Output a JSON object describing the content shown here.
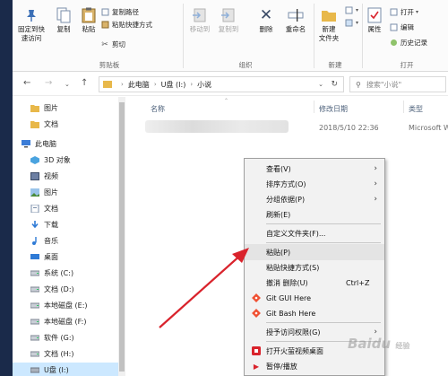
{
  "ribbon": {
    "pin": "固定到快\n速访问",
    "copy": "复制",
    "paste": "粘贴",
    "copy_path": "复制路径",
    "paste_shortcut": "粘贴快捷方式",
    "cut": "剪切",
    "clipboard_group": "剪贴板",
    "move_to": "移动到",
    "copy_to": "复制到",
    "delete": "删除",
    "rename": "重命名",
    "organize_group": "组织",
    "new_folder": "新建\n文件夹",
    "new_group": "新建",
    "properties": "属性",
    "open": "打开",
    "edit": "编辑",
    "history": "历史记录",
    "open_group": "打开"
  },
  "address": {
    "path": [
      "此电脑",
      "U盘 (I:)",
      "小说"
    ],
    "search_placeholder": "搜索\"小说\""
  },
  "nav": {
    "items": [
      {
        "label": "图片",
        "icon": "folder-icon"
      },
      {
        "label": "文档",
        "icon": "folder-icon"
      },
      {
        "label": "此电脑",
        "icon": "computer-icon"
      },
      {
        "label": "3D 对象",
        "icon": "cube-icon"
      },
      {
        "label": "视频",
        "icon": "video-icon"
      },
      {
        "label": "图片",
        "icon": "picture-icon"
      },
      {
        "label": "文档",
        "icon": "document-icon"
      },
      {
        "label": "下载",
        "icon": "download-icon"
      },
      {
        "label": "音乐",
        "icon": "music-icon"
      },
      {
        "label": "桌面",
        "icon": "desktop-icon"
      },
      {
        "label": "系统 (C:)",
        "icon": "drive-icon"
      },
      {
        "label": "文档 (D:)",
        "icon": "drive-icon"
      },
      {
        "label": "本地磁盘 (E:)",
        "icon": "drive-icon"
      },
      {
        "label": "本地磁盘 (F:)",
        "icon": "drive-icon"
      },
      {
        "label": "软件 (G:)",
        "icon": "drive-icon"
      },
      {
        "label": "文档 (H:)",
        "icon": "drive-icon"
      },
      {
        "label": "U盘 (I:)",
        "icon": "usb-drive-icon"
      }
    ]
  },
  "list": {
    "col_name": "名称",
    "col_date": "修改日期",
    "col_type": "类型",
    "row_date": "2018/5/10 22:36",
    "row_type": "Microsoft W"
  },
  "menu": {
    "view": "查看(V)",
    "sort": "排序方式(O)",
    "group": "分组依据(P)",
    "refresh": "刷新(E)",
    "customize": "自定义文件夹(F)...",
    "paste": "粘贴(P)",
    "paste_shortcut": "粘贴快捷方式(S)",
    "undo": "撤消 删除(U)",
    "undo_shortcut": "Ctrl+Z",
    "git_gui": "Git GUI Here",
    "git_bash": "Git Bash Here",
    "give_access": "授予访问权限(G)",
    "open_recorder": "打开火萤视频桌面",
    "pause_play": "暂停/播放"
  },
  "watermark": {
    "brand": "Baidu",
    "sub": "经验"
  },
  "colors": {
    "accent_arrow": "#d9232c",
    "selected_bg": "#cce8ff",
    "folder_yellow": "#e8b84a"
  }
}
